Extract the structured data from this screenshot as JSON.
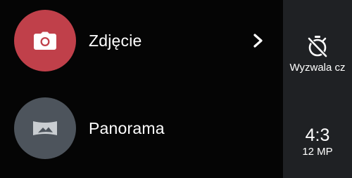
{
  "modes": {
    "photo": {
      "label": "Zdjęcie",
      "icon": "camera-icon",
      "color": "#c0404a"
    },
    "panorama": {
      "label": "Panorama",
      "icon": "panorama-icon",
      "color": "#4d545c"
    }
  },
  "expand": {
    "icon": "chevron-right-icon"
  },
  "settings": {
    "timer": {
      "icon": "timer-off-icon",
      "label": "Wyzwala cz"
    },
    "aspect_ratio": {
      "value": "4:3",
      "megapixels": "12 MP"
    }
  },
  "colors": {
    "background": "#050505",
    "panel": "#1f2124",
    "text": "#ffffff"
  }
}
